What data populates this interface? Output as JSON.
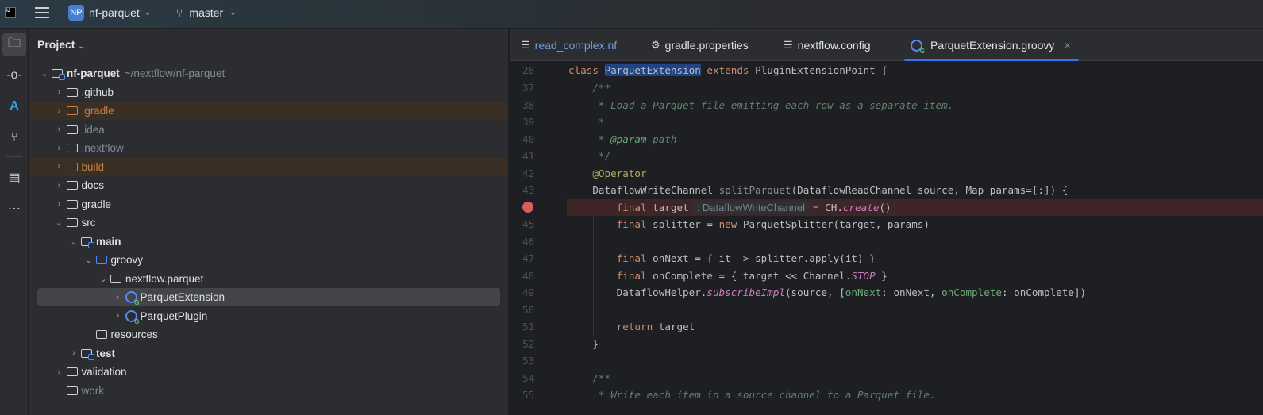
{
  "titlebar": {
    "project_initials": "NP",
    "project_name": "nf-parquet",
    "branch": "master"
  },
  "toolstrip": [
    "project-icon",
    "commit-icon",
    "azure-icon",
    "pull-requests-icon",
    "structure-icon",
    "more-icon"
  ],
  "project_panel": {
    "title": "Project",
    "tree": [
      {
        "label": "nf-parquet",
        "path": "~/nextflow/nf-parquet",
        "depth": 0,
        "exp": "open",
        "icon": "mod",
        "bold": true
      },
      {
        "label": ".github",
        "depth": 1,
        "exp": "closed",
        "icon": "folder"
      },
      {
        "label": ".gradle",
        "depth": 1,
        "exp": "closed",
        "icon": "orange",
        "style": "orange",
        "hl": true
      },
      {
        "label": ".idea",
        "depth": 1,
        "exp": "closed",
        "icon": "folder",
        "style": "dim"
      },
      {
        "label": ".nextflow",
        "depth": 1,
        "exp": "closed",
        "icon": "folder",
        "style": "dim"
      },
      {
        "label": "build",
        "depth": 1,
        "exp": "closed",
        "icon": "orange",
        "style": "orange",
        "hl": true
      },
      {
        "label": "docs",
        "depth": 1,
        "exp": "closed",
        "icon": "folder"
      },
      {
        "label": "gradle",
        "depth": 1,
        "exp": "closed",
        "icon": "folder"
      },
      {
        "label": "src",
        "depth": 1,
        "exp": "open",
        "icon": "folder"
      },
      {
        "label": "main",
        "depth": 2,
        "exp": "open",
        "icon": "mod",
        "bold": true
      },
      {
        "label": "groovy",
        "depth": 3,
        "exp": "open",
        "icon": "blue"
      },
      {
        "label": "nextflow.parquet",
        "depth": 4,
        "exp": "open",
        "icon": "folder"
      },
      {
        "label": "ParquetExtension",
        "depth": 5,
        "exp": "closed",
        "icon": "groovy",
        "sel": true
      },
      {
        "label": "ParquetPlugin",
        "depth": 5,
        "exp": "closed",
        "icon": "groovy"
      },
      {
        "label": "resources",
        "depth": 3,
        "exp": "none",
        "icon": "folder"
      },
      {
        "label": "test",
        "depth": 2,
        "exp": "closed",
        "icon": "mod",
        "bold": true
      },
      {
        "label": "validation",
        "depth": 1,
        "exp": "closed",
        "icon": "folder"
      },
      {
        "label": "work",
        "depth": 1,
        "exp": "none",
        "icon": "folder",
        "style": "dim"
      }
    ]
  },
  "tabs": [
    {
      "label": "read_complex.nf",
      "icon": "lines",
      "color": "#6f9fe0"
    },
    {
      "label": "gradle.properties",
      "icon": "gear"
    },
    {
      "label": "nextflow.config",
      "icon": "lines"
    },
    {
      "label": "ParquetExtension.groovy",
      "icon": "groovy",
      "active": true,
      "close": "×"
    }
  ],
  "editor": {
    "inlay_hint": ": DataflowWriteChannel",
    "lines": [
      {
        "n": "28",
        "sticky": true,
        "t": [
          [
            "class ",
            "kw"
          ],
          [
            "ParquetExtension",
            "selw"
          ],
          [
            " extends ",
            "kw"
          ],
          [
            "PluginExtensionPoint {",
            ""
          ]
        ]
      },
      {
        "n": "37",
        "t": [
          [
            "    /**",
            "cm"
          ]
        ]
      },
      {
        "n": "38",
        "t": [
          [
            "     * Load a Parquet file emitting each row as a separate item.",
            "cm"
          ]
        ]
      },
      {
        "n": "39",
        "t": [
          [
            "     *",
            "cm"
          ]
        ]
      },
      {
        "n": "40",
        "t": [
          [
            "     * ",
            "cm"
          ],
          [
            "@param",
            "tg"
          ],
          [
            " path",
            "cm"
          ]
        ]
      },
      {
        "n": "41",
        "t": [
          [
            "     */",
            "cm"
          ]
        ]
      },
      {
        "n": "42",
        "t": [
          [
            "    @Operator",
            "an"
          ]
        ]
      },
      {
        "n": "43",
        "t": [
          [
            "    DataflowWriteChannel ",
            ""
          ],
          [
            "splitParquet",
            "un"
          ],
          [
            "(DataflowReadChannel source, Map params=[:]) {",
            ""
          ]
        ]
      },
      {
        "n": "44",
        "bp": true,
        "t": [
          [
            "        final ",
            "kw"
          ],
          [
            "target",
            ""
          ],
          [
            "HINT",
            "hint"
          ],
          [
            "= CH.",
            ""
          ],
          [
            "create",
            "st"
          ],
          [
            "()",
            ""
          ]
        ]
      },
      {
        "n": "45",
        "t": [
          [
            "        final ",
            "kw"
          ],
          [
            "splitter = ",
            ""
          ],
          [
            "new ",
            "kw"
          ],
          [
            "ParquetSplitter(target, params)",
            ""
          ]
        ]
      },
      {
        "n": "46",
        "t": []
      },
      {
        "n": "47",
        "t": [
          [
            "        final ",
            "kw"
          ],
          [
            "onNext = { it -> splitter.apply(it) }",
            ""
          ]
        ]
      },
      {
        "n": "48",
        "t": [
          [
            "        final ",
            "kw"
          ],
          [
            "onComplete = { target << Channel.",
            ""
          ],
          [
            "STOP",
            "st"
          ],
          [
            " }",
            ""
          ]
        ]
      },
      {
        "n": "49",
        "t": [
          [
            "        DataflowHelper.",
            ""
          ],
          [
            "subscribeImpl",
            "st"
          ],
          [
            "(source, [",
            ""
          ],
          [
            "onNext",
            "na"
          ],
          [
            ": onNext, ",
            ""
          ],
          [
            "onComplete",
            "na"
          ],
          [
            ": onComplete])",
            ""
          ]
        ]
      },
      {
        "n": "50",
        "t": []
      },
      {
        "n": "51",
        "t": [
          [
            "        return ",
            "kw"
          ],
          [
            "target",
            ""
          ]
        ]
      },
      {
        "n": "52",
        "t": [
          [
            "    }",
            ""
          ]
        ]
      },
      {
        "n": "53",
        "t": []
      },
      {
        "n": "54",
        "t": [
          [
            "    /**",
            "cm"
          ]
        ]
      },
      {
        "n": "55",
        "t": [
          [
            "     * Write each item in a source channel to a Parquet file.",
            "cm"
          ]
        ]
      }
    ]
  }
}
